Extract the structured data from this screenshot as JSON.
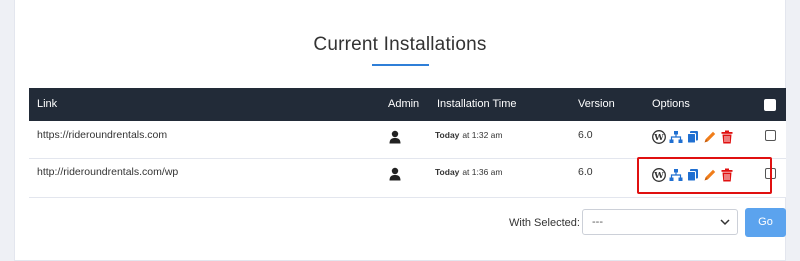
{
  "title": "Current Installations",
  "table": {
    "headers": {
      "link": "Link",
      "admin": "Admin",
      "installation_time": "Installation Time",
      "version": "Version",
      "options": "Options"
    },
    "rows": [
      {
        "link": "https://rideroundrentals.com",
        "day": "Today",
        "at": "at 1:32 am",
        "version": "6.0",
        "selected": false
      },
      {
        "link": "http://rideroundrentals.com/wp",
        "day": "Today",
        "at": "at 1:36 am",
        "version": "6.0",
        "selected": false
      }
    ],
    "option_icons": [
      "wordpress-icon",
      "sitemap-icon",
      "copy-icon",
      "pencil-icon",
      "trash-icon"
    ]
  },
  "bulk": {
    "label": "With Selected:",
    "selected_value": "---",
    "go_label": "Go"
  },
  "colors": {
    "header_bg": "#222b38",
    "accent": "#2f7fd8",
    "delete": "#e01010",
    "edit": "#f07d1a",
    "go_button": "#5ba3ee"
  }
}
